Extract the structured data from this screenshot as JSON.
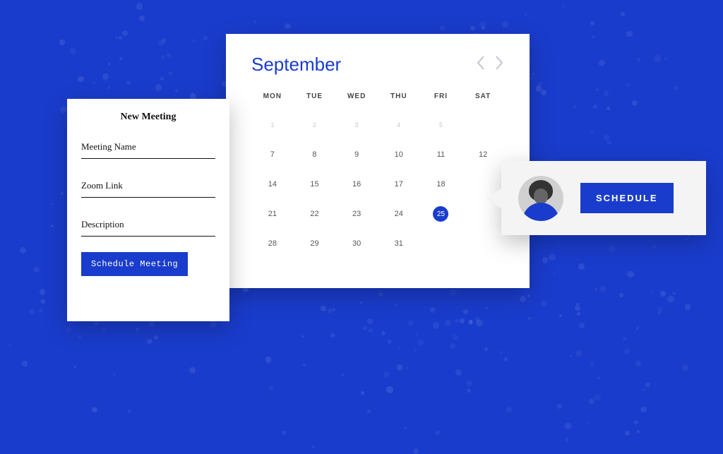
{
  "colors": {
    "brand": "#1a3ccc",
    "panel": "#ffffff",
    "popover": "#f4f4f4"
  },
  "calendar": {
    "month_label": "September",
    "weekdays": [
      "MON",
      "TUE",
      "WED",
      "THU",
      "FRI",
      "SAT"
    ],
    "rows": [
      [
        {
          "d": "1",
          "m": true
        },
        {
          "d": "2",
          "m": true
        },
        {
          "d": "3",
          "m": true
        },
        {
          "d": "4",
          "m": true
        },
        {
          "d": "5",
          "m": true
        },
        {
          "d": "",
          "m": true
        }
      ],
      [
        {
          "d": "7"
        },
        {
          "d": "8"
        },
        {
          "d": "9"
        },
        {
          "d": "10"
        },
        {
          "d": "11"
        },
        {
          "d": "12"
        }
      ],
      [
        {
          "d": "14"
        },
        {
          "d": "15"
        },
        {
          "d": "16"
        },
        {
          "d": "17"
        },
        {
          "d": "18"
        },
        {
          "d": ""
        }
      ],
      [
        {
          "d": "21"
        },
        {
          "d": "22"
        },
        {
          "d": "23"
        },
        {
          "d": "24"
        },
        {
          "d": "25",
          "sel": true
        },
        {
          "d": ""
        }
      ],
      [
        {
          "d": "28"
        },
        {
          "d": "29"
        },
        {
          "d": "30"
        },
        {
          "d": "31"
        },
        {
          "d": ""
        },
        {
          "d": ""
        }
      ]
    ]
  },
  "form": {
    "title": "New Meeting",
    "fields": {
      "name_label": "Meeting Name",
      "link_label": "Zoom Link",
      "desc_label": "Description"
    },
    "submit_label": "Schedule Meeting"
  },
  "popover": {
    "button_label": "SCHEDULE",
    "icon": "avatar"
  }
}
